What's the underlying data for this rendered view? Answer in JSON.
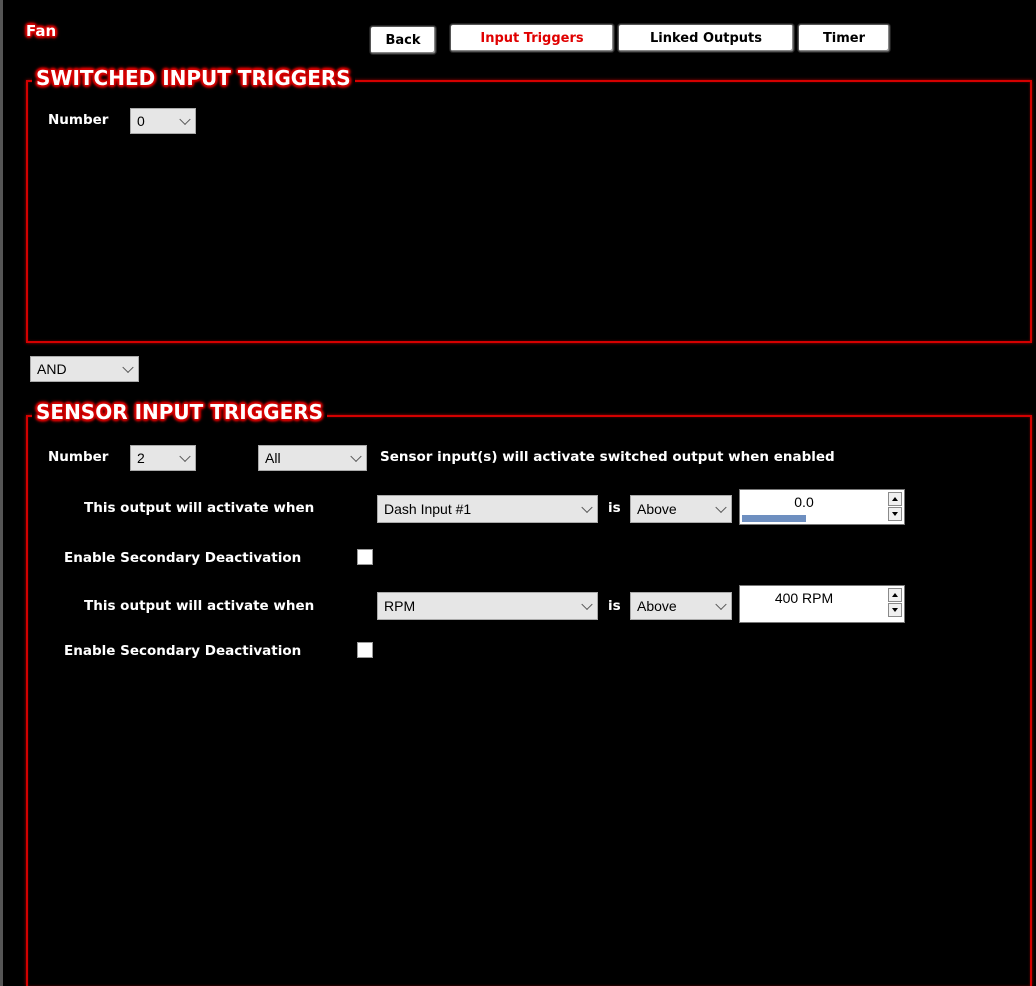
{
  "app": {
    "title": "Fan"
  },
  "tabs": {
    "back": "Back",
    "input_triggers": "Input Triggers",
    "linked_outputs": "Linked Outputs",
    "timer": "Timer"
  },
  "switched": {
    "title": "SWITCHED INPUT TRIGGERS",
    "number_label": "Number",
    "number_value": "0"
  },
  "logic_select": {
    "value": "AND"
  },
  "sensor": {
    "title": "SENSOR INPUT TRIGGERS",
    "number_label": "Number",
    "number_value": "2",
    "mode_value": "All",
    "description": "Sensor input(s) will activate switched output when enabled",
    "rows": [
      {
        "label": "This output will activate when",
        "input": "Dash Input #1",
        "is_label": "is",
        "condition": "Above",
        "value": "0.0",
        "bar_fraction": 0.5,
        "secondary_label": "Enable Secondary Deactivation",
        "secondary_checked": false
      },
      {
        "label": "This output will activate when",
        "input": "RPM",
        "is_label": "is",
        "condition": "Above",
        "value": "400 RPM",
        "bar_fraction": 0.0,
        "secondary_label": "Enable Secondary Deactivation",
        "secondary_checked": false
      }
    ]
  },
  "colors": {
    "accent_red": "#d40000",
    "active_tab_text": "#e00000",
    "progress_fill": "#6e8fc0",
    "background": "#000000"
  },
  "icons": {
    "dropdown": "chevron-down-icon",
    "spin_up": "arrow-up-icon",
    "spin_down": "arrow-down-icon"
  }
}
